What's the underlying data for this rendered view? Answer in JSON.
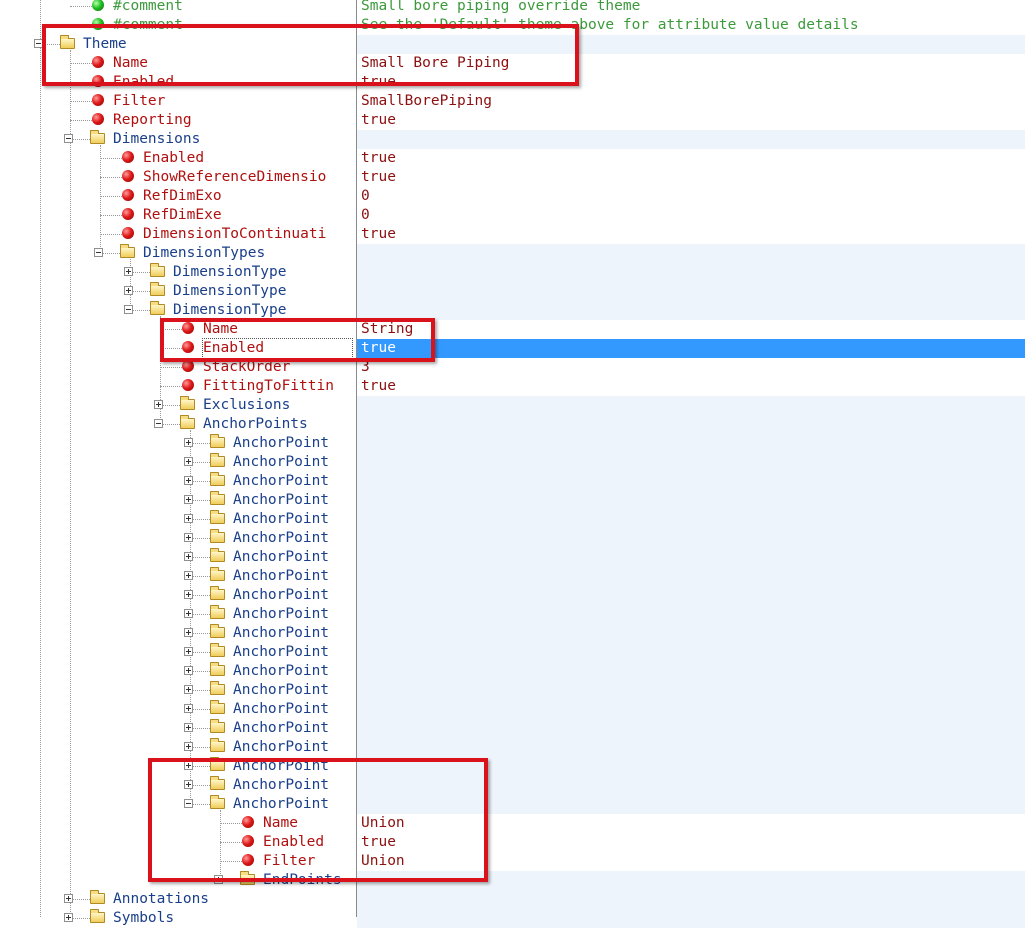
{
  "tree": {
    "comment1": {
      "name": "#comment",
      "value": "Small bore piping override theme"
    },
    "comment2": {
      "name": "#comment",
      "value": "See the 'Default' theme above for attribute value details"
    },
    "theme": {
      "label": "Theme"
    },
    "theme_name": {
      "name": "Name",
      "value": "Small Bore Piping"
    },
    "theme_enabled": {
      "name": "Enabled",
      "value": "true"
    },
    "theme_filter": {
      "name": "Filter",
      "value": "SmallBorePiping"
    },
    "theme_reporting": {
      "name": "Reporting",
      "value": "true"
    },
    "dimensions": {
      "label": "Dimensions"
    },
    "dim_enabled": {
      "name": "Enabled",
      "value": "true"
    },
    "dim_showref": {
      "name": "ShowReferenceDimensio",
      "value": "true"
    },
    "dim_refexo": {
      "name": "RefDimExo",
      "value": "0"
    },
    "dim_refexe": {
      "name": "RefDimExe",
      "value": "0"
    },
    "dim_tocont": {
      "name": "DimensionToContinuati",
      "value": "true"
    },
    "dimension_types": {
      "label": "DimensionTypes"
    },
    "dimension_type_label": "DimensionType",
    "dt3_name": {
      "name": "Name",
      "value": "String"
    },
    "dt3_enabled": {
      "name": "Enabled",
      "value": "true"
    },
    "dt3_stackorder": {
      "name": "StackOrder",
      "value": "3"
    },
    "dt3_fitting": {
      "name": "FittingToFittin",
      "value": "true"
    },
    "exclusions": {
      "label": "Exclusions"
    },
    "anchor_points": {
      "label": "AnchorPoints"
    },
    "anchor_point_label": "AnchorPoint",
    "ap_name": {
      "name": "Name",
      "value": "Union"
    },
    "ap_enabled": {
      "name": "Enabled",
      "value": "true"
    },
    "ap_filter": {
      "name": "Filter",
      "value": "Union"
    },
    "endpoints": {
      "label": "EndPoints"
    },
    "annotations": {
      "label": "Annotations"
    },
    "symbols": {
      "label": "Symbols"
    }
  },
  "colors": {
    "element": "#1a3f8a",
    "attribute": "#b01010",
    "value": "#8b1010",
    "comment": "#3c9a3c",
    "selection": "#3399ff",
    "highlight_box": "#d9121b"
  },
  "icons": {
    "attribute": "red-dot-icon",
    "comment": "green-dot-icon",
    "element": "folder-icon",
    "expander": "expand-collapse-icon"
  }
}
